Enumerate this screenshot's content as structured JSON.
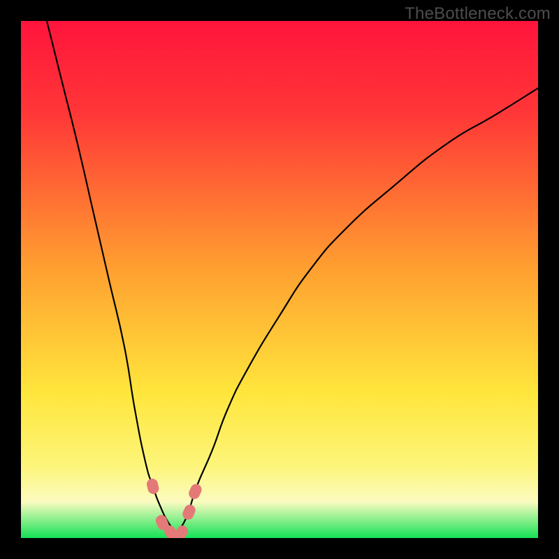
{
  "watermark": "TheBottleneck.com",
  "colors": {
    "frame_bg": "#000000",
    "gradient_top": "#ff143c",
    "gradient_mid_red": "#ff3737",
    "gradient_mid_orange": "#ffa030",
    "gradient_mid_yellow": "#ffe63c",
    "gradient_low_yellow": "#fdf57a",
    "gradient_pale": "#fbfbc0",
    "gradient_green": "#14e256",
    "curve_stroke": "#000000",
    "marker_fill": "#e47a78",
    "marker_stroke": "#e47a78"
  },
  "chart_data": {
    "type": "line",
    "title": "",
    "xlabel": "",
    "ylabel": "",
    "xlim": [
      0,
      100
    ],
    "ylim": [
      0,
      100
    ],
    "note": "Values are read off the image as percentages of the inner plot area (origin bottom-left). The curve is a V-shaped valley with two branches.",
    "series": [
      {
        "name": "left-branch",
        "x": [
          5,
          8,
          11,
          14,
          17,
          20,
          22,
          24,
          25.5,
          27,
          28.5,
          30
        ],
        "y": [
          100,
          88,
          76,
          63,
          50,
          37,
          25,
          15,
          10,
          6,
          3,
          1
        ]
      },
      {
        "name": "right-branch",
        "x": [
          30,
          32,
          34,
          37,
          40,
          44,
          50,
          56,
          63,
          72,
          82,
          92,
          100
        ],
        "y": [
          1,
          4,
          10,
          17,
          25,
          33,
          43,
          52,
          60,
          68,
          76,
          82,
          87
        ]
      }
    ],
    "markers": [
      {
        "name": "left-marker-upper",
        "x": 25.5,
        "y": 10
      },
      {
        "name": "left-marker-lower",
        "x": 27.3,
        "y": 3
      },
      {
        "name": "valley-marker-a",
        "x": 29.0,
        "y": 1
      },
      {
        "name": "valley-marker-b",
        "x": 31.0,
        "y": 1
      },
      {
        "name": "right-marker-lower",
        "x": 32.5,
        "y": 5
      },
      {
        "name": "right-marker-upper",
        "x": 33.7,
        "y": 9
      }
    ]
  }
}
